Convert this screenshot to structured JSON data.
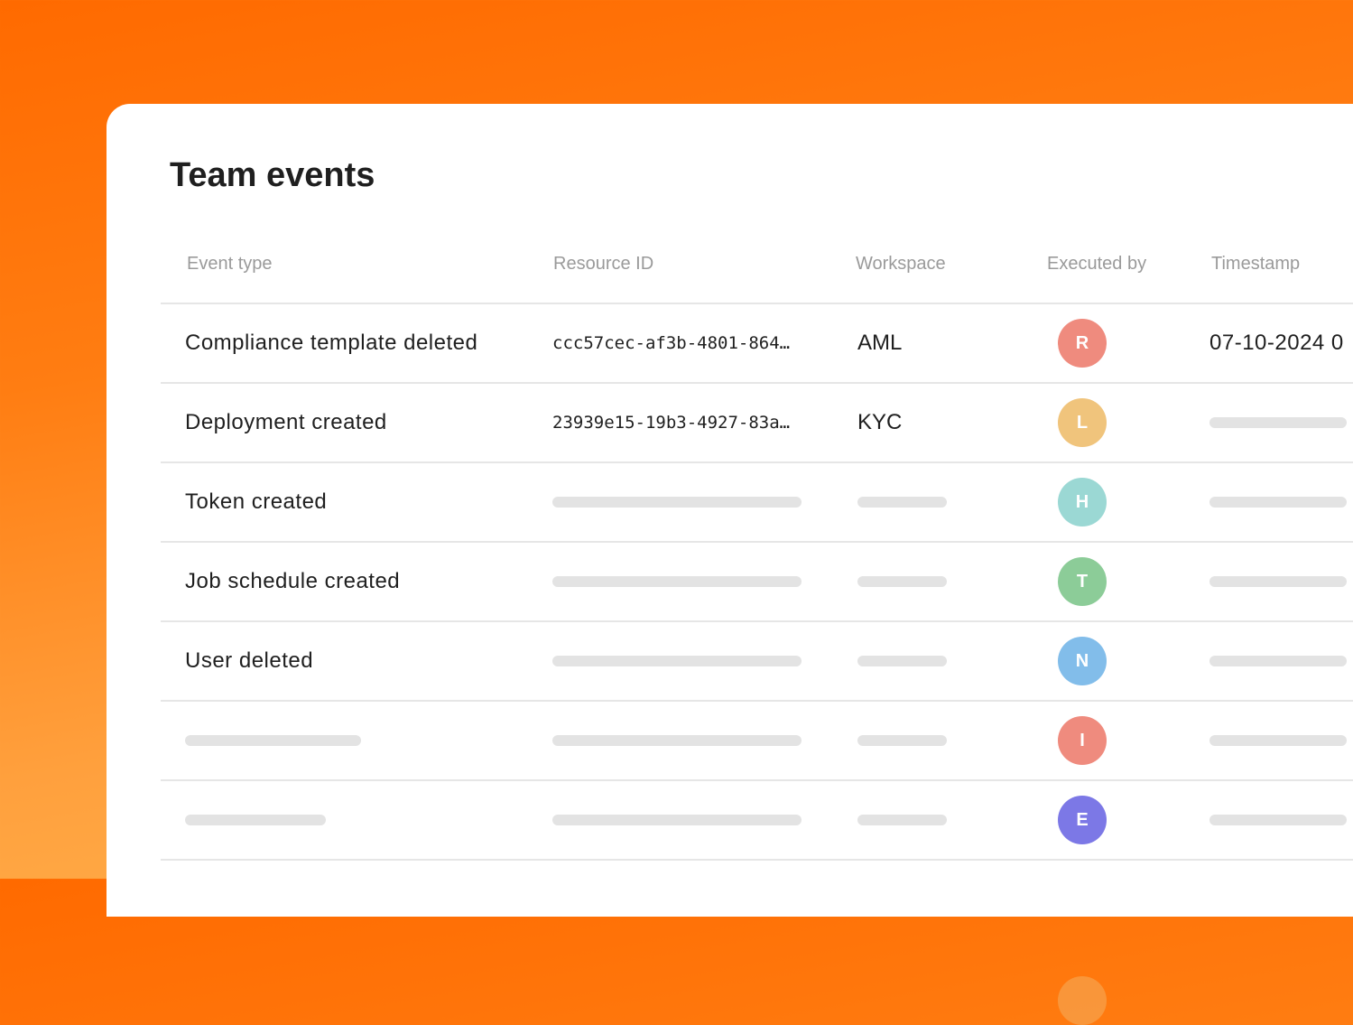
{
  "title": "Team events",
  "columns": {
    "event_type": "Event type",
    "resource_id": "Resource ID",
    "workspace": "Workspace",
    "executed_by": "Executed by",
    "timestamp": "Timestamp"
  },
  "rows": [
    {
      "event": "Compliance template deleted",
      "resource": "ccc57cec-af3b-4801-864…",
      "workspace": "AML",
      "user": "R",
      "color": "#ef8b7e",
      "timestamp": "07-10-2024 0"
    },
    {
      "event": "Deployment created",
      "resource": "23939e15-19b3-4927-83a…",
      "workspace": "KYC",
      "user": "L",
      "color": "#f0c47c",
      "timestamp": ""
    },
    {
      "event": "Token created",
      "resource": "",
      "workspace": "",
      "user": "H",
      "color": "#9bd8d4",
      "timestamp": ""
    },
    {
      "event": "Job schedule created",
      "resource": "",
      "workspace": "",
      "user": "T",
      "color": "#8ccc98",
      "timestamp": ""
    },
    {
      "event": "User deleted",
      "resource": "",
      "workspace": "",
      "user": "N",
      "color": "#82bdea",
      "timestamp": ""
    },
    {
      "event": "",
      "resource": "",
      "workspace": "",
      "user": "I",
      "color": "#ef8b7e",
      "timestamp": ""
    },
    {
      "event": "",
      "resource": "",
      "workspace": "",
      "user": "E",
      "color": "#7c78e6",
      "timestamp": ""
    }
  ]
}
